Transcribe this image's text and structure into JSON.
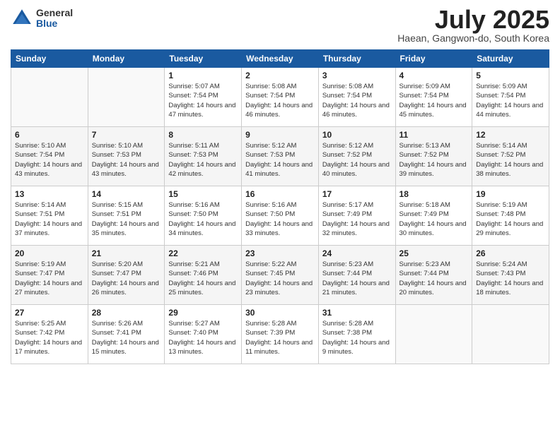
{
  "logo": {
    "general": "General",
    "blue": "Blue"
  },
  "title": "July 2025",
  "subtitle": "Haean, Gangwon-do, South Korea",
  "headers": [
    "Sunday",
    "Monday",
    "Tuesday",
    "Wednesday",
    "Thursday",
    "Friday",
    "Saturday"
  ],
  "weeks": [
    [
      {
        "day": "",
        "info": ""
      },
      {
        "day": "",
        "info": ""
      },
      {
        "day": "1",
        "info": "Sunrise: 5:07 AM\nSunset: 7:54 PM\nDaylight: 14 hours\nand 47 minutes."
      },
      {
        "day": "2",
        "info": "Sunrise: 5:08 AM\nSunset: 7:54 PM\nDaylight: 14 hours\nand 46 minutes."
      },
      {
        "day": "3",
        "info": "Sunrise: 5:08 AM\nSunset: 7:54 PM\nDaylight: 14 hours\nand 46 minutes."
      },
      {
        "day": "4",
        "info": "Sunrise: 5:09 AM\nSunset: 7:54 PM\nDaylight: 14 hours\nand 45 minutes."
      },
      {
        "day": "5",
        "info": "Sunrise: 5:09 AM\nSunset: 7:54 PM\nDaylight: 14 hours\nand 44 minutes."
      }
    ],
    [
      {
        "day": "6",
        "info": "Sunrise: 5:10 AM\nSunset: 7:54 PM\nDaylight: 14 hours\nand 43 minutes."
      },
      {
        "day": "7",
        "info": "Sunrise: 5:10 AM\nSunset: 7:53 PM\nDaylight: 14 hours\nand 43 minutes."
      },
      {
        "day": "8",
        "info": "Sunrise: 5:11 AM\nSunset: 7:53 PM\nDaylight: 14 hours\nand 42 minutes."
      },
      {
        "day": "9",
        "info": "Sunrise: 5:12 AM\nSunset: 7:53 PM\nDaylight: 14 hours\nand 41 minutes."
      },
      {
        "day": "10",
        "info": "Sunrise: 5:12 AM\nSunset: 7:52 PM\nDaylight: 14 hours\nand 40 minutes."
      },
      {
        "day": "11",
        "info": "Sunrise: 5:13 AM\nSunset: 7:52 PM\nDaylight: 14 hours\nand 39 minutes."
      },
      {
        "day": "12",
        "info": "Sunrise: 5:14 AM\nSunset: 7:52 PM\nDaylight: 14 hours\nand 38 minutes."
      }
    ],
    [
      {
        "day": "13",
        "info": "Sunrise: 5:14 AM\nSunset: 7:51 PM\nDaylight: 14 hours\nand 37 minutes."
      },
      {
        "day": "14",
        "info": "Sunrise: 5:15 AM\nSunset: 7:51 PM\nDaylight: 14 hours\nand 35 minutes."
      },
      {
        "day": "15",
        "info": "Sunrise: 5:16 AM\nSunset: 7:50 PM\nDaylight: 14 hours\nand 34 minutes."
      },
      {
        "day": "16",
        "info": "Sunrise: 5:16 AM\nSunset: 7:50 PM\nDaylight: 14 hours\nand 33 minutes."
      },
      {
        "day": "17",
        "info": "Sunrise: 5:17 AM\nSunset: 7:49 PM\nDaylight: 14 hours\nand 32 minutes."
      },
      {
        "day": "18",
        "info": "Sunrise: 5:18 AM\nSunset: 7:49 PM\nDaylight: 14 hours\nand 30 minutes."
      },
      {
        "day": "19",
        "info": "Sunrise: 5:19 AM\nSunset: 7:48 PM\nDaylight: 14 hours\nand 29 minutes."
      }
    ],
    [
      {
        "day": "20",
        "info": "Sunrise: 5:19 AM\nSunset: 7:47 PM\nDaylight: 14 hours\nand 27 minutes."
      },
      {
        "day": "21",
        "info": "Sunrise: 5:20 AM\nSunset: 7:47 PM\nDaylight: 14 hours\nand 26 minutes."
      },
      {
        "day": "22",
        "info": "Sunrise: 5:21 AM\nSunset: 7:46 PM\nDaylight: 14 hours\nand 25 minutes."
      },
      {
        "day": "23",
        "info": "Sunrise: 5:22 AM\nSunset: 7:45 PM\nDaylight: 14 hours\nand 23 minutes."
      },
      {
        "day": "24",
        "info": "Sunrise: 5:23 AM\nSunset: 7:44 PM\nDaylight: 14 hours\nand 21 minutes."
      },
      {
        "day": "25",
        "info": "Sunrise: 5:23 AM\nSunset: 7:44 PM\nDaylight: 14 hours\nand 20 minutes."
      },
      {
        "day": "26",
        "info": "Sunrise: 5:24 AM\nSunset: 7:43 PM\nDaylight: 14 hours\nand 18 minutes."
      }
    ],
    [
      {
        "day": "27",
        "info": "Sunrise: 5:25 AM\nSunset: 7:42 PM\nDaylight: 14 hours\nand 17 minutes."
      },
      {
        "day": "28",
        "info": "Sunrise: 5:26 AM\nSunset: 7:41 PM\nDaylight: 14 hours\nand 15 minutes."
      },
      {
        "day": "29",
        "info": "Sunrise: 5:27 AM\nSunset: 7:40 PM\nDaylight: 14 hours\nand 13 minutes."
      },
      {
        "day": "30",
        "info": "Sunrise: 5:28 AM\nSunset: 7:39 PM\nDaylight: 14 hours\nand 11 minutes."
      },
      {
        "day": "31",
        "info": "Sunrise: 5:28 AM\nSunset: 7:38 PM\nDaylight: 14 hours\nand 9 minutes."
      },
      {
        "day": "",
        "info": ""
      },
      {
        "day": "",
        "info": ""
      }
    ]
  ]
}
